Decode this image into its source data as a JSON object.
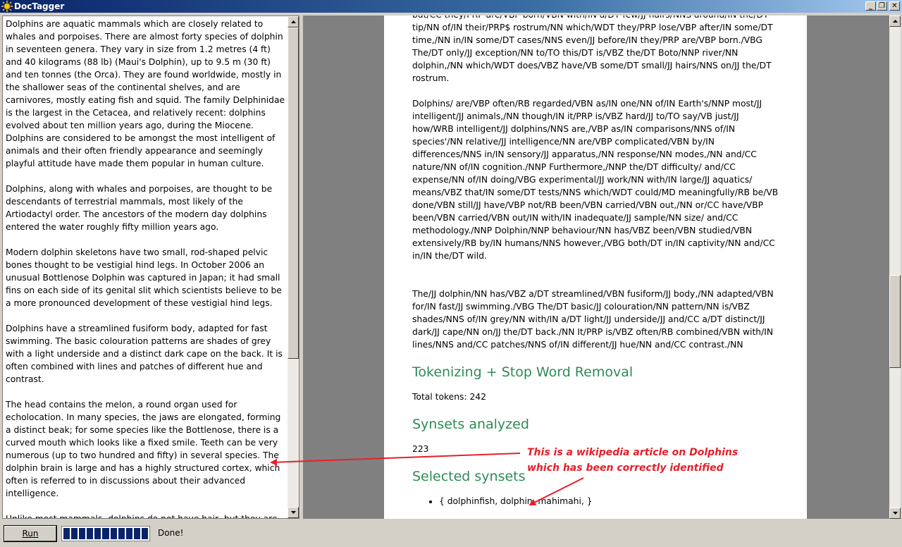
{
  "window": {
    "title": "DocTagger",
    "controls": [
      "_",
      "❐",
      "✕"
    ]
  },
  "left_text": [
    "Dolphins are aquatic mammals which are closely related to whales and porpoises. There are almost forty species of dolphin in seventeen genera. They vary in size from 1.2 metres (4 ft) and 40 kilograms (88 lb) (Maui's Dolphin), up to 9.5 m (30 ft) and ten tonnes (the Orca). They are found worldwide, mostly in the shallower seas of the continental shelves, and are carnivores, mostly eating fish and squid. The family Delphinidae is the largest in the Cetacea, and relatively recent: dolphins evolved about ten million years ago, during the Miocene. Dolphins are considered to be amongst the most intelligent of animals and their often friendly appearance and seemingly playful attitude have made them popular in human culture.",
    "Dolphins, along with whales and porpoises, are thought to be descendants of terrestrial mammals, most likely of the Artiodactyl order. The ancestors of the modern day dolphins entered the water roughly fifty million years ago.",
    "Modern dolphin skeletons have two small, rod-shaped pelvic bones thought to be vestigial hind legs. In October 2006 an unusual Bottlenose Dolphin was captured in Japan; it had small fins on each side of its genital slit which scientists believe to be a more pronounced development of these vestigial hind legs.",
    "Dolphins have a streamlined fusiform body, adapted for fast swimming. The basic colouration patterns are shades of grey with a light underside and a distinct dark cape on the back. It is often combined with lines and patches of different hue and contrast.",
    "The head contains the melon, a round organ used for echolocation. In many species, the jaws are elongated, forming a distinct beak; for some species like the Bottlenose, there is a curved mouth which looks like a fixed smile. Teeth can be very numerous (up to two hundred and fifty) in several species. The dolphin brain is large and has a highly structured cortex, which often is referred to in discussions about their advanced intelligence.",
    "Unlike most mammals, dolphins do not have hair, but they are born with a few hairs around the tip of their rostrum which they lose"
  ],
  "tagged": [
    "but/CC they/PRP are/VBP born/VBN with/IN a/DT few/JJ hairs/NNS around/IN the/DT tip/NN of/IN their/PRP$ rostrum/NN which/WDT they/PRP lose/VBP after/IN some/DT time,/NN in/IN some/DT cases/NNS even/JJ before/IN they/PRP are/VBP born./VBG The/DT only/JJ exception/NN to/TO this/DT is/VBZ the/DT Boto/NNP river/NN dolphin,/NN which/WDT does/VBZ have/VB some/DT small/JJ hairs/NNS on/JJ the/DT rostrum.",
    "Dolphins/ are/VBP often/RB regarded/VBN as/IN one/NN of/IN Earth's/NNP most/JJ intelligent/JJ animals,/NN though/IN it/PRP is/VBZ hard/JJ to/TO say/VB just/JJ how/WRB intelligent/JJ dolphins/NNS are,/VBP as/IN comparisons/NNS of/IN species'/NN relative/JJ intelligence/NN are/VBP complicated/VBN by/IN differences/NNS in/IN sensory/JJ apparatus,/NN response/NN modes,/NN and/CC nature/NN of/IN cognition./NNP Furthermore,/NNP the/DT difficulty/ and/CC expense/NN of/IN doing/VBG experimental/JJ work/NN with/IN large/JJ aquatics/ means/VBZ that/IN some/DT tests/NNS which/WDT could/MD meaningfully/RB be/VB done/VBN still/JJ have/VBP not/RB been/VBN carried/VBN out,/NN or/CC have/VBP been/VBN carried/VBN out/IN with/IN inadequate/JJ sample/NN size/ and/CC methodology./NNP Dolphin/NNP behaviour/NN has/VBZ been/VBN studied/VBN extensively/RB by/IN humans/NNS however,/VBG both/DT in/IN captivity/NN and/CC in/IN the/DT wild.",
    "The/JJ dolphin/NN has/VBZ a/DT streamlined/VBN fusiform/JJ body,/NN adapted/VBN for/IN fast/JJ swimming./VBG The/DT basic/JJ colouration/NN pattern/NN is/VBZ shades/NNS of/IN grey/NN with/IN a/DT light/JJ underside/JJ and/CC a/DT distinct/JJ dark/JJ cape/NN on/JJ the/DT back./NN It/PRP is/VBZ often/RB combined/VBN with/IN lines/NNS and/CC patches/NNS of/IN different/JJ hue/NN and/CC contrast./NN"
  ],
  "sections": {
    "tokenizing_title": "Tokenizing + Stop Word Removal",
    "total_tokens": "Total tokens: 242",
    "synsets_title": "Synsets analyzed",
    "synsets_count": "223",
    "selected_title": "Selected synsets",
    "selected_items": [
      "{ dolphinfish, dolphin, mahimahi, }"
    ]
  },
  "annotation": {
    "line1": "This is a wikipedia article on Dolphins",
    "line2": "which has been correctly identified",
    "color": "#e5202a"
  },
  "bottom": {
    "run_label": "Run",
    "status": "Done!",
    "progress_fraction": 1.0,
    "progress_blocks": 11
  }
}
